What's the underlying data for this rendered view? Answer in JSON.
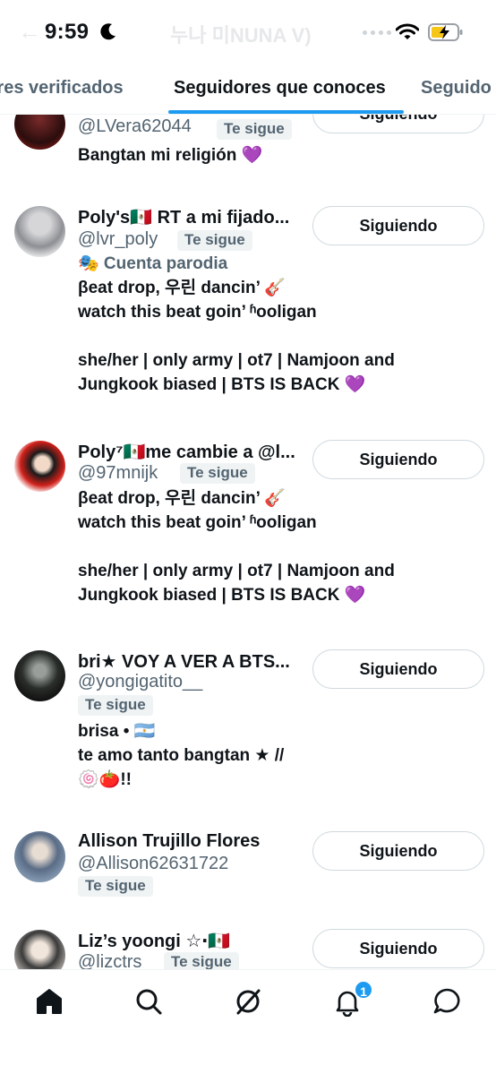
{
  "status_bar": {
    "time": "9:59",
    "faded_title": "누나 미NUNA V)"
  },
  "tabs": [
    {
      "label": "dores verificados",
      "active": false
    },
    {
      "label": "Seguidores que conoces",
      "active": true
    },
    {
      "label": "Seguido",
      "active": false
    }
  ],
  "badge_label": "Te sigue",
  "follow_button_label": "Siguiendo",
  "users": [
    {
      "name": "",
      "handle": "@LVera62044",
      "bio": "Bangtan mi religión 💜"
    },
    {
      "name": "Poly's🇲🇽 RT a mi fijado...",
      "handle": "@lvr_poly",
      "parody": "🎭 Cuenta parodia",
      "bio": "βeat drop, 우린 dancin’ 🎸\nwatch this beat goin’ ʱooligan\n\nshe/her | only army | ot7 | Namjoon and\nJungkook biased | BTS IS BACK 💜"
    },
    {
      "name": "Poly⁷🇲🇽me cambie a @l...",
      "handle": "@97mnijk",
      "bio": "βeat drop, 우린 dancin’ 🎸\nwatch this beat goin’ ʱooligan\n\nshe/her | only army | ot7 | Namjoon and\nJungkook biased | BTS IS BACK 💜"
    },
    {
      "name": "bri★ VOY A VER A BTS...",
      "handle": "@yongigatito__",
      "bio": "brisa • 🇦🇷\nte amo tanto bangtan ★ //\n🍥🍅!!"
    },
    {
      "name": "Allison Trujillo Flores",
      "handle": "@Allison62631722",
      "bio": ""
    },
    {
      "name": "Liz’s yoongi ☆‧🇲🇽",
      "handle": "@lizctrs",
      "bio": ""
    }
  ],
  "bottom_nav": {
    "notifications_count": "1"
  },
  "colors": {
    "accent": "#1d9bf0",
    "text": "#0f1419",
    "secondary": "#536471"
  }
}
